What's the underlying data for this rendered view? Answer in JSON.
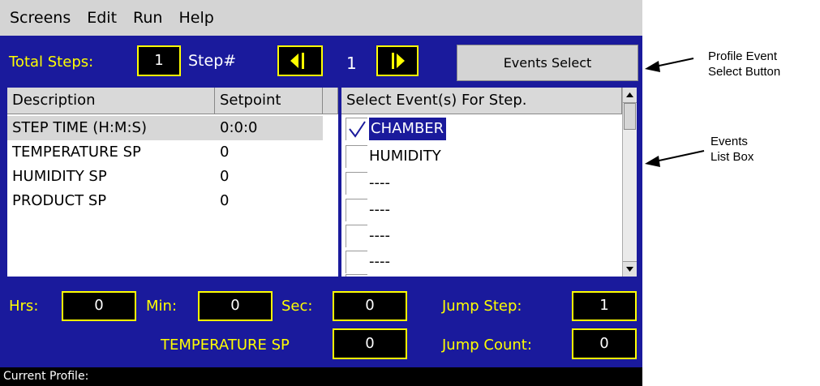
{
  "menu": [
    "Screens",
    "Edit",
    "Run",
    "Help"
  ],
  "top": {
    "total_steps_label": "Total Steps:",
    "total_steps_value": "1",
    "step_label": "Step#",
    "step_value": "1",
    "events_select_label": "Events Select"
  },
  "step_table": {
    "headers": [
      "Description",
      "Setpoint"
    ],
    "rows": [
      {
        "description": "STEP TIME (H:M:S)",
        "setpoint": "0:0:0",
        "selected": true
      },
      {
        "description": "TEMPERATURE SP",
        "setpoint": "0"
      },
      {
        "description": "HUMIDITY SP",
        "setpoint": "0"
      },
      {
        "description": "PRODUCT SP",
        "setpoint": "0"
      }
    ]
  },
  "events": {
    "header": "Select Event(s) For Step.",
    "items": [
      {
        "label": "CHAMBER",
        "checked": true,
        "selected": true
      },
      {
        "label": "HUMIDITY",
        "checked": false
      },
      {
        "label": "----",
        "checked": false
      },
      {
        "label": "----",
        "checked": false
      },
      {
        "label": "----",
        "checked": false
      },
      {
        "label": "----",
        "checked": false
      }
    ]
  },
  "time": {
    "hrs_label": "Hrs:",
    "hrs_value": "0",
    "min_label": "Min:",
    "min_value": "0",
    "sec_label": "Sec:",
    "sec_value": "0"
  },
  "jump": {
    "step_label": "Jump Step:",
    "step_value": "1",
    "count_label": "Jump Count:",
    "count_value": "0"
  },
  "setpoint_entry": {
    "label": "TEMPERATURE SP",
    "value": "0"
  },
  "status": {
    "current_profile_label": "Current Profile:"
  },
  "annotations": {
    "profile_event_button": "Profile Event\nSelect Button",
    "events_list_box": "Events\nList Box"
  },
  "colors": {
    "screen_bg": "#1a1a9c",
    "accent_yellow": "#ffff00",
    "selection": "#1a1a9c"
  }
}
